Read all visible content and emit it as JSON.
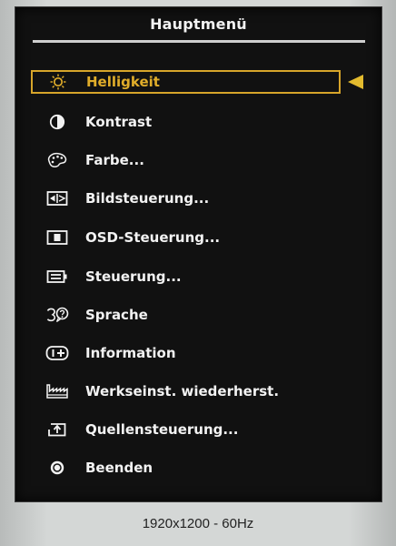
{
  "window": {
    "title": "Hauptmenü",
    "status_text": "1920x1200 - 60Hz"
  },
  "colors": {
    "background": "#111111",
    "selection": "#d7a52a",
    "pointer": "#e3bb2e",
    "text": "#f2f2f2"
  },
  "menu": {
    "items": [
      {
        "label": "Helligkeit",
        "icon": "brightness-sun-icon",
        "selected": true
      },
      {
        "label": "Kontrast",
        "icon": "contrast-icon",
        "selected": false
      },
      {
        "label": "Farbe...",
        "icon": "palette-icon",
        "selected": false
      },
      {
        "label": "Bildsteuerung...",
        "icon": "image-control-icon",
        "selected": false
      },
      {
        "label": "OSD-Steuerung...",
        "icon": "osd-control-icon",
        "selected": false
      },
      {
        "label": "Steuerung...",
        "icon": "control-icon",
        "selected": false
      },
      {
        "label": "Sprache",
        "icon": "language-icon",
        "selected": false
      },
      {
        "label": "Information",
        "icon": "information-icon",
        "selected": false
      },
      {
        "label": "Werkseinst. wiederherst.",
        "icon": "factory-reset-icon",
        "selected": false
      },
      {
        "label": "Quellensteuerung...",
        "icon": "source-control-icon",
        "selected": false
      },
      {
        "label": "Beenden",
        "icon": "exit-icon",
        "selected": false
      }
    ]
  }
}
